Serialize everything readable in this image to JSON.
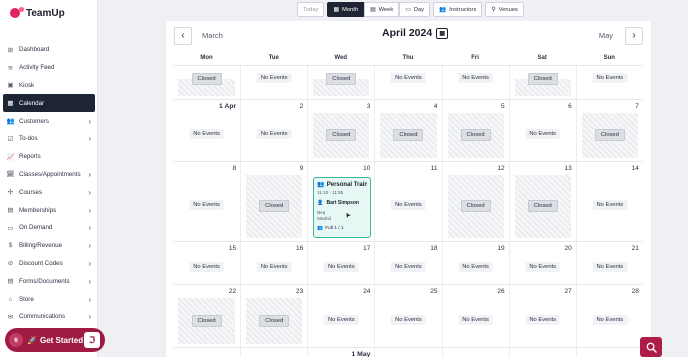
{
  "brand": {
    "name": "TeamUp"
  },
  "sidebar": {
    "items": [
      {
        "label": "Dashboard",
        "icon": "dashboard-icon",
        "glyph": "⊞",
        "chevron": false,
        "active": false
      },
      {
        "label": "Activity Feed",
        "icon": "activity-icon",
        "glyph": "≋",
        "chevron": false,
        "active": false
      },
      {
        "label": "Kiosk",
        "icon": "kiosk-icon",
        "glyph": "▣",
        "chevron": false,
        "active": false
      },
      {
        "label": "Calendar",
        "icon": "calendar-icon",
        "glyph": "▦",
        "chevron": false,
        "active": true
      },
      {
        "label": "Customers",
        "icon": "customers-icon",
        "glyph": "👥",
        "chevron": true,
        "active": false
      },
      {
        "label": "To-dos",
        "icon": "todos-icon",
        "glyph": "☑",
        "chevron": true,
        "active": false
      },
      {
        "label": "Reports",
        "icon": "reports-icon",
        "glyph": "📈",
        "chevron": false,
        "active": false
      },
      {
        "label": "Classes/Appointments",
        "icon": "classes-icon",
        "glyph": "🗓",
        "chevron": true,
        "active": false
      },
      {
        "label": "Courses",
        "icon": "courses-icon",
        "glyph": "✣",
        "chevron": true,
        "active": false
      },
      {
        "label": "Memberships",
        "icon": "memberships-icon",
        "glyph": "▤",
        "chevron": true,
        "active": false
      },
      {
        "label": "On Demand",
        "icon": "on-demand-icon",
        "glyph": "▭",
        "chevron": true,
        "active": false
      },
      {
        "label": "Billing/Revenue",
        "icon": "billing-icon",
        "glyph": "$",
        "chevron": true,
        "active": false
      },
      {
        "label": "Discount Codes",
        "icon": "discount-icon",
        "glyph": "⊘",
        "chevron": true,
        "active": false
      },
      {
        "label": "Forms/Documents",
        "icon": "forms-icon",
        "glyph": "▤",
        "chevron": true,
        "active": false
      },
      {
        "label": "Store",
        "icon": "store-icon",
        "glyph": "⌂",
        "chevron": true,
        "active": false
      },
      {
        "label": "Communications",
        "icon": "communications-icon",
        "glyph": "✉",
        "chevron": true,
        "active": false
      }
    ]
  },
  "get_started": {
    "count": "6",
    "label": "Get Started"
  },
  "toolbar": {
    "today": "Today",
    "month": "Month",
    "week": "Week",
    "day": "Day",
    "instructors": "Instructors",
    "venues": "Venues"
  },
  "calendar": {
    "prev_month": "March",
    "current": "April 2024",
    "next_month": "May",
    "day_names": [
      "Mon",
      "Tue",
      "Wed",
      "Thu",
      "Fri",
      "Sat",
      "Sun"
    ],
    "closed_label": "Closed",
    "no_events_label": "No Events",
    "weeks": [
      {
        "height": 34,
        "days": [
          {
            "date": "",
            "status": "closed"
          },
          {
            "date": "",
            "status": "none"
          },
          {
            "date": "",
            "status": "closed"
          },
          {
            "date": "",
            "status": "none"
          },
          {
            "date": "",
            "status": "none"
          },
          {
            "date": "",
            "status": "closed"
          },
          {
            "date": "",
            "status": "none"
          }
        ]
      },
      {
        "height": 62,
        "days": [
          {
            "date": "1 Apr",
            "status": "none",
            "bold": true
          },
          {
            "date": "2",
            "status": "none"
          },
          {
            "date": "3",
            "status": "closed"
          },
          {
            "date": "4",
            "status": "closed"
          },
          {
            "date": "5",
            "status": "closed"
          },
          {
            "date": "6",
            "status": "none"
          },
          {
            "date": "7",
            "status": "closed"
          }
        ]
      },
      {
        "height": 80,
        "days": [
          {
            "date": "8",
            "status": "none"
          },
          {
            "date": "9",
            "status": "closed"
          },
          {
            "date": "10",
            "status": "event"
          },
          {
            "date": "11",
            "status": "none"
          },
          {
            "date": "12",
            "status": "closed"
          },
          {
            "date": "13",
            "status": "closed"
          },
          {
            "date": "14",
            "status": "none"
          }
        ]
      },
      {
        "height": 43,
        "days": [
          {
            "date": "15",
            "status": "none"
          },
          {
            "date": "16",
            "status": "none"
          },
          {
            "date": "17",
            "status": "none"
          },
          {
            "date": "18",
            "status": "none"
          },
          {
            "date": "19",
            "status": "none"
          },
          {
            "date": "20",
            "status": "none"
          },
          {
            "date": "21",
            "status": "none"
          }
        ]
      },
      {
        "height": 63,
        "days": [
          {
            "date": "22",
            "status": "closed"
          },
          {
            "date": "23",
            "status": "closed"
          },
          {
            "date": "24",
            "status": "none"
          },
          {
            "date": "25",
            "status": "none"
          },
          {
            "date": "26",
            "status": "none"
          },
          {
            "date": "27",
            "status": "none"
          },
          {
            "date": "28",
            "status": "none"
          }
        ]
      },
      {
        "height": 20,
        "days": [
          {
            "date": "",
            "status": "blank"
          },
          {
            "date": "",
            "status": "blank"
          },
          {
            "date": "1 May",
            "status": "blank",
            "bold": true
          },
          {
            "date": "",
            "status": "blank"
          },
          {
            "date": "",
            "status": "blank"
          },
          {
            "date": "",
            "status": "blank"
          },
          {
            "date": "",
            "status": "blank"
          }
        ]
      }
    ],
    "event": {
      "title": "Personal Training 1",
      "time": "11:10 - 11:55",
      "instructor": "Bart Simpson",
      "location_line1": "Beq",
      "location_line2": "Madrid",
      "capacity": "Full 1 / 1"
    }
  }
}
